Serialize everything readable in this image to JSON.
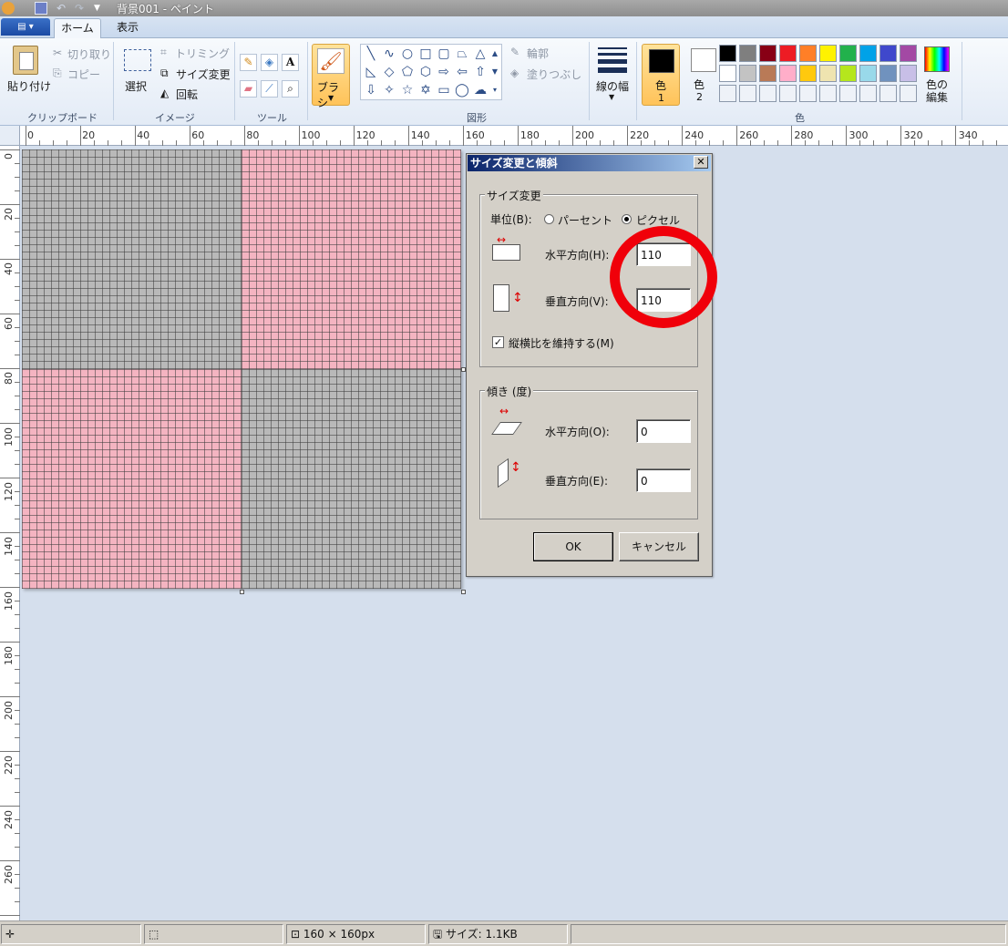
{
  "window": {
    "title": "背景001 - ペイント"
  },
  "tabs": {
    "home": "ホーム",
    "view": "表示"
  },
  "ribbon": {
    "clipboard": {
      "paste": "貼り付け",
      "cut": "切り取り",
      "copy": "コピー",
      "group": "クリップボード"
    },
    "image": {
      "select": "選択",
      "crop": "トリミング",
      "resize": "サイズ変更",
      "rotate": "回転",
      "group": "イメージ"
    },
    "tools": {
      "group": "ツール"
    },
    "brushes": {
      "label": "ブラシ"
    },
    "shapes": {
      "outline": "輪郭",
      "fill": "塗りつぶし",
      "group": "図形"
    },
    "size": {
      "label": "線の幅"
    },
    "colors": {
      "color1": "色",
      "color1_num": "1",
      "color2": "色",
      "color2_num": "2",
      "edit": "色の編集",
      "group": "色",
      "palette": [
        "#000000",
        "#7f7f7f",
        "#880015",
        "#ed1c24",
        "#ff7f27",
        "#fff200",
        "#22b14c",
        "#00a2e8",
        "#3f48cc",
        "#a349a4",
        "#ffffff",
        "#c3c3c3",
        "#b97a57",
        "#ffaec9",
        "#ffc90e",
        "#efe4b0",
        "#b5e61d",
        "#99d9ea",
        "#7092be",
        "#c8bfe7",
        "",
        "",
        "",
        "",
        "",
        "",
        "",
        "",
        "",
        ""
      ]
    }
  },
  "ruler": {
    "h_labels": [
      "0",
      "20",
      "40",
      "60",
      "80",
      "100",
      "120",
      "140",
      "160",
      "180",
      "200",
      "220",
      "240",
      "260",
      "280",
      "300",
      "320",
      "340"
    ],
    "v_labels": [
      "0",
      "20",
      "40",
      "60",
      "80",
      "100",
      "120",
      "140",
      "160",
      "180",
      "200",
      "220",
      "240",
      "260"
    ]
  },
  "dialog": {
    "title": "サイズ変更と傾斜",
    "close": "✕",
    "resize_group": "サイズ変更",
    "unit_label": "単位(B):",
    "unit_percent": "パーセント",
    "unit_pixel": "ピクセル",
    "horizontal_label": "水平方向(H):",
    "horizontal_value": "110",
    "vertical_label": "垂直方向(V):",
    "vertical_value": "110",
    "keep_ratio": "縦横比を維持する(M)",
    "skew_group": "傾き (度)",
    "skew_h_label": "水平方向(O):",
    "skew_h_value": "0",
    "skew_v_label": "垂直方向(E):",
    "skew_v_value": "0",
    "ok": "OK",
    "cancel": "キャンセル"
  },
  "status": {
    "dimensions": "160 × 160px",
    "size": "サイズ: 1.1KB"
  }
}
